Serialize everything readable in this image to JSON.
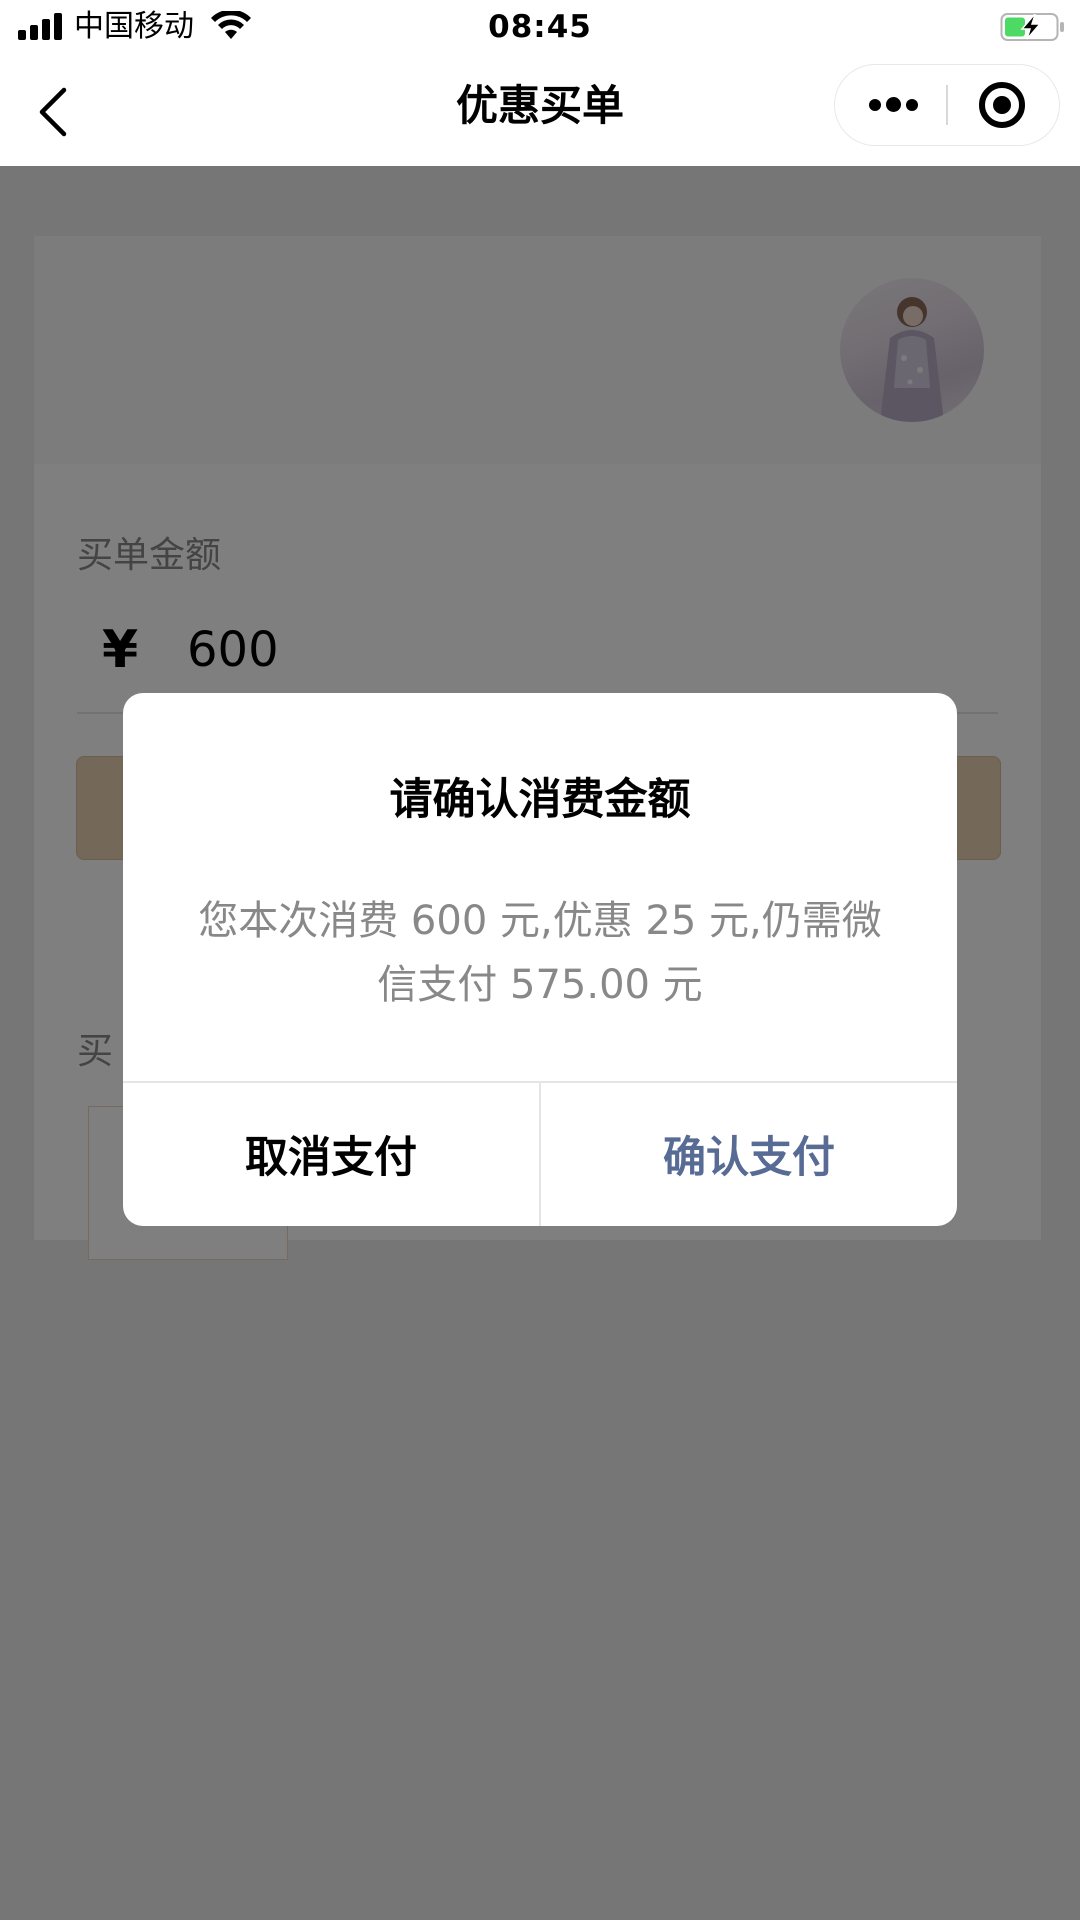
{
  "status_bar": {
    "carrier": "中国移动",
    "time": "08:45",
    "battery_color": "#4cd964"
  },
  "nav": {
    "title": "优惠买单"
  },
  "page": {
    "amount_label": "买单金额",
    "currency": "¥",
    "amount_value": "600",
    "section_label_partial": "买"
  },
  "dialog": {
    "title": "请确认消费金额",
    "message": "您本次消费 600 元,优惠 25 元,仍需微信支付 575.00 元",
    "cancel_label": "取消支付",
    "confirm_label": "确认支付",
    "confirm_color": "#576b95"
  },
  "colors": {
    "mask": "rgba(0,0,0,0.5)",
    "pay_button": "#e8d3b1"
  }
}
